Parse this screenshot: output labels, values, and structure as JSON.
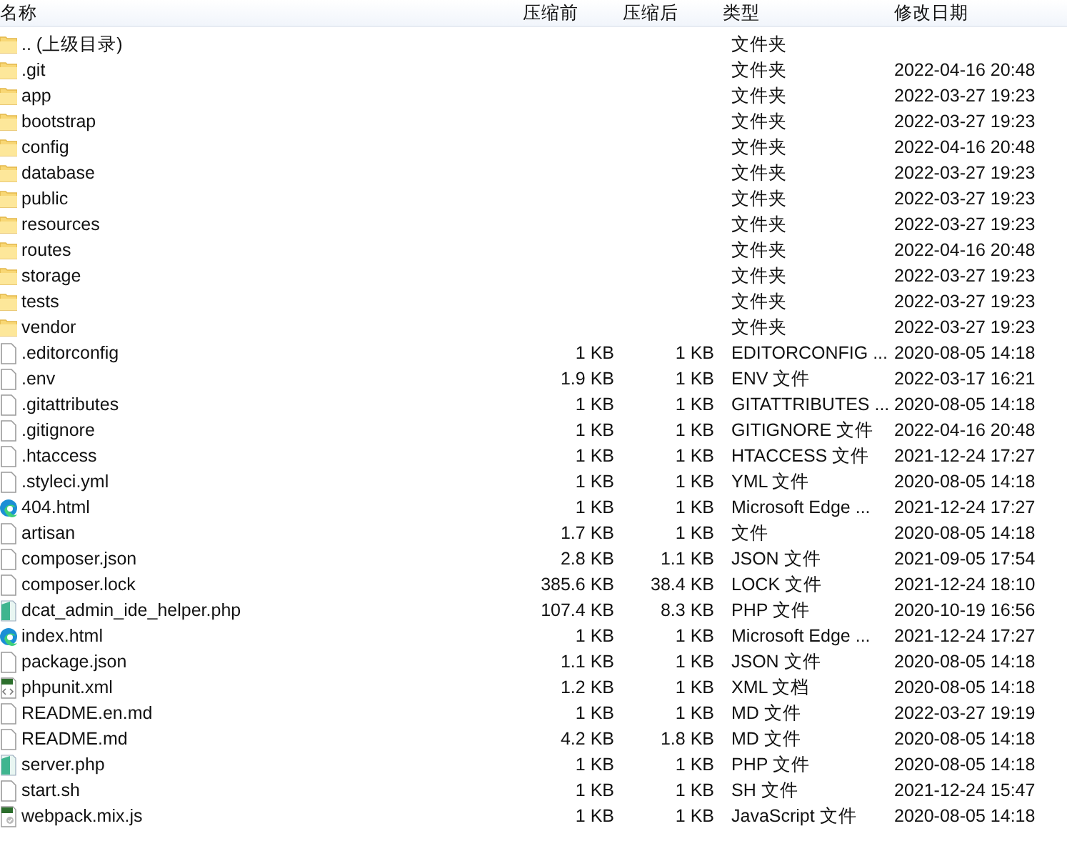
{
  "columns": [
    "名称",
    "压缩前",
    "压缩后",
    "类型",
    "修改日期"
  ],
  "rows": [
    {
      "kind": "folder",
      "name": ".. (上级目录)",
      "type": "文件夹"
    },
    {
      "kind": "folder",
      "name": ".git",
      "type": "文件夹",
      "date": "2022-04-16 20:48"
    },
    {
      "kind": "folder",
      "name": "app",
      "type": "文件夹",
      "date": "2022-03-27 19:23"
    },
    {
      "kind": "folder",
      "name": "bootstrap",
      "type": "文件夹",
      "date": "2022-03-27 19:23"
    },
    {
      "kind": "folder",
      "name": "config",
      "type": "文件夹",
      "date": "2022-04-16 20:48"
    },
    {
      "kind": "folder",
      "name": "database",
      "type": "文件夹",
      "date": "2022-03-27 19:23"
    },
    {
      "kind": "folder",
      "name": "public",
      "type": "文件夹",
      "date": "2022-03-27 19:23"
    },
    {
      "kind": "folder",
      "name": "resources",
      "type": "文件夹",
      "date": "2022-03-27 19:23"
    },
    {
      "kind": "folder",
      "name": "routes",
      "type": "文件夹",
      "date": "2022-04-16 20:48"
    },
    {
      "kind": "folder",
      "name": "storage",
      "type": "文件夹",
      "date": "2022-03-27 19:23"
    },
    {
      "kind": "folder",
      "name": "tests",
      "type": "文件夹",
      "date": "2022-03-27 19:23"
    },
    {
      "kind": "folder",
      "name": "vendor",
      "type": "文件夹",
      "date": "2022-03-27 19:23"
    },
    {
      "kind": "file",
      "name": ".editorconfig",
      "size": "1 KB",
      "packed": "1 KB",
      "type": "EDITORCONFIG ...",
      "date": "2020-08-05 14:18"
    },
    {
      "kind": "file",
      "name": ".env",
      "size": "1.9 KB",
      "packed": "1 KB",
      "type": "ENV 文件",
      "date": "2022-03-17 16:21"
    },
    {
      "kind": "file",
      "name": ".gitattributes",
      "size": "1 KB",
      "packed": "1 KB",
      "type": "GITATTRIBUTES ...",
      "date": "2020-08-05 14:18"
    },
    {
      "kind": "file",
      "name": ".gitignore",
      "size": "1 KB",
      "packed": "1 KB",
      "type": "GITIGNORE 文件",
      "date": "2022-04-16 20:48"
    },
    {
      "kind": "file",
      "name": ".htaccess",
      "size": "1 KB",
      "packed": "1 KB",
      "type": "HTACCESS 文件",
      "date": "2021-12-24 17:27"
    },
    {
      "kind": "file",
      "name": ".styleci.yml",
      "size": "1 KB",
      "packed": "1 KB",
      "type": "YML 文件",
      "date": "2020-08-05 14:18"
    },
    {
      "kind": "edge",
      "name": "404.html",
      "size": "1 KB",
      "packed": "1 KB",
      "type": "Microsoft Edge ...",
      "date": "2021-12-24 17:27"
    },
    {
      "kind": "file",
      "name": "artisan",
      "size": "1.7 KB",
      "packed": "1 KB",
      "type": "文件",
      "date": "2020-08-05 14:18"
    },
    {
      "kind": "file",
      "name": "composer.json",
      "size": "2.8 KB",
      "packed": "1.1 KB",
      "type": "JSON 文件",
      "date": "2021-09-05 17:54"
    },
    {
      "kind": "file",
      "name": "composer.lock",
      "size": "385.6 KB",
      "packed": "38.4 KB",
      "type": "LOCK 文件",
      "date": "2021-12-24 18:10"
    },
    {
      "kind": "php",
      "name": "dcat_admin_ide_helper.php",
      "size": "107.4 KB",
      "packed": "8.3 KB",
      "type": "PHP 文件",
      "date": "2020-10-19 16:56"
    },
    {
      "kind": "edge",
      "name": "index.html",
      "size": "1 KB",
      "packed": "1 KB",
      "type": "Microsoft Edge ...",
      "date": "2021-12-24 17:27"
    },
    {
      "kind": "file",
      "name": "package.json",
      "size": "1.1 KB",
      "packed": "1 KB",
      "type": "JSON 文件",
      "date": "2020-08-05 14:18"
    },
    {
      "kind": "xml",
      "name": "phpunit.xml",
      "size": "1.2 KB",
      "packed": "1 KB",
      "type": "XML 文档",
      "date": "2020-08-05 14:18"
    },
    {
      "kind": "file",
      "name": "README.en.md",
      "size": "1 KB",
      "packed": "1 KB",
      "type": "MD 文件",
      "date": "2022-03-27 19:19"
    },
    {
      "kind": "file",
      "name": "README.md",
      "size": "4.2 KB",
      "packed": "1.8 KB",
      "type": "MD 文件",
      "date": "2020-08-05 14:18"
    },
    {
      "kind": "php",
      "name": "server.php",
      "size": "1 KB",
      "packed": "1 KB",
      "type": "PHP 文件",
      "date": "2020-08-05 14:18"
    },
    {
      "kind": "file",
      "name": "start.sh",
      "size": "1 KB",
      "packed": "1 KB",
      "type": "SH 文件",
      "date": "2021-12-24 15:47"
    },
    {
      "kind": "js",
      "name": "webpack.mix.js",
      "size": "1 KB",
      "packed": "1 KB",
      "type": "JavaScript 文件",
      "date": "2020-08-05 14:18"
    }
  ]
}
